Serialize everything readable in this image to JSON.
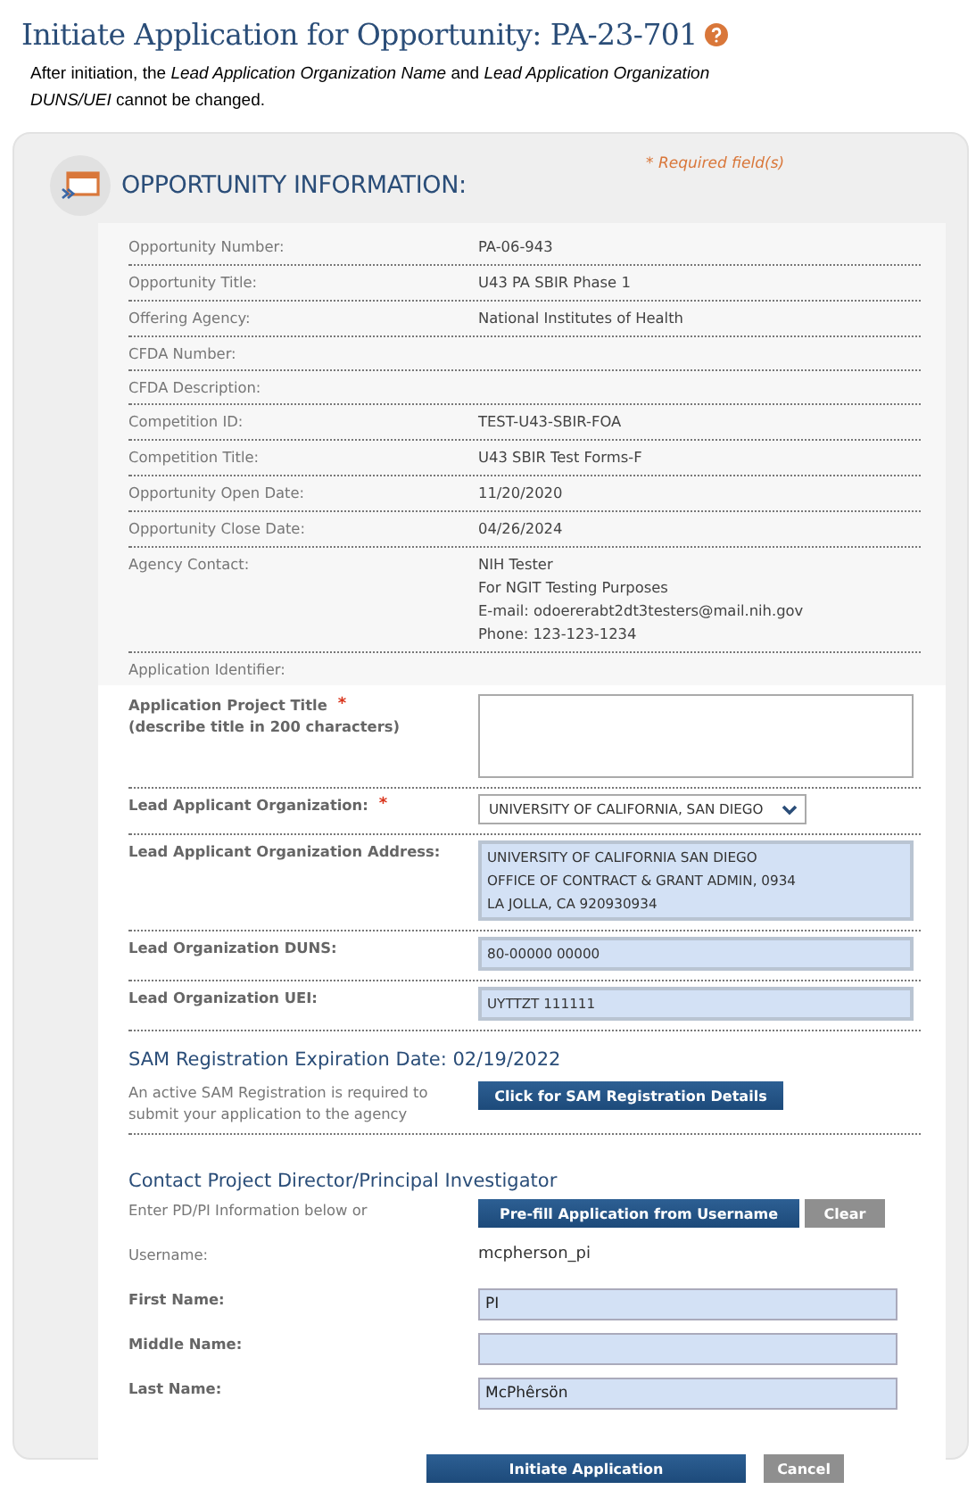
{
  "title": "Initiate Application for Opportunity: PA-23-701",
  "note": "After initiation, the *Lead Application Organization Name* and *Lead Application Organization DUNS/UEI* cannot be changed.",
  "panel": {
    "heading": "OPPORTUNITY INFORMATION:",
    "required_note": "* Required field(s)"
  },
  "info_rows": [
    {
      "label": "Opportunity Number:",
      "lines": [
        "PA-06-943"
      ]
    },
    {
      "label": "Opportunity Title:",
      "lines": [
        "U43 PA SBIR Phase 1"
      ]
    },
    {
      "label": "Offering Agency:",
      "lines": [
        "National Institutes of Health"
      ]
    },
    {
      "label": "CFDA Number:",
      "lines": []
    },
    {
      "label": "CFDA Description:",
      "lines": []
    },
    {
      "label": "Competition ID:",
      "lines": [
        "TEST-U43-SBIR-FOA"
      ]
    },
    {
      "label": "Competition Title:",
      "lines": [
        "U43 SBIR Test Forms-F"
      ]
    },
    {
      "label": "Opportunity Open Date:",
      "lines": [
        "11/20/2020"
      ]
    },
    {
      "label": "Opportunity Close Date:",
      "lines": [
        "04/26/2024"
      ]
    },
    {
      "label": "Agency Contact:",
      "lines": [
        "NIH Tester",
        "For NGIT Testing Purposes",
        "E-mail: odoererabt2dt3testers@mail.nih.gov",
        "Phone: 123-123-1234"
      ]
    },
    {
      "label": "Application Identifier:",
      "lines": []
    }
  ],
  "form_rows": [
    {
      "kind": "textarea",
      "label": "Application Project Title",
      "mark": "*",
      "hint": "(describe title in 200 characters)"
    },
    {
      "kind": "select",
      "label": "Lead Applicant Organization:",
      "mark": "*",
      "value": "UNIVERSITY OF CALIFORNIA, SAN DIEGO"
    },
    {
      "kind": "readonly",
      "label": "Lead Applicant Organization Address:",
      "lines": [
        "UNIVERSITY OF CALIFORNIA SAN DIEGO",
        "OFFICE OF CONTRACT & GRANT ADMIN, 0934",
        "LA JOLLA, CA 920930934"
      ]
    },
    {
      "kind": "readonly",
      "label": "Lead Organization DUNS:",
      "lines": [
        "80-00000 00000"
      ]
    },
    {
      "kind": "readonly",
      "label": "Lead Organization UEI:",
      "lines": [
        "UYTTZT 111111"
      ]
    }
  ],
  "sam": {
    "heading": "SAM Registration Expiration Date: 02/19/2022",
    "text": "An active SAM Registration is required to submit your application to the agency",
    "button": "Click for SAM Registration Details"
  },
  "contact": {
    "heading": "Contact Project Director/Principal Investigator",
    "intro": "Enter PD/PI Information below or",
    "prefill_button": "Pre-fill Application from Username",
    "clear_button": "Clear",
    "username_label": "Username:",
    "username": "mcpherson_pi",
    "fields": [
      {
        "label": "First Name:",
        "value": "PI"
      },
      {
        "label": "Middle Name:"
      },
      {
        "label": "Last Name:",
        "value": "McPhêrsön"
      }
    ]
  },
  "actions": [
    {
      "kind": "primary",
      "label": "Initiate Application"
    },
    {
      "kind": "secondary",
      "label": "Cancel"
    }
  ]
}
